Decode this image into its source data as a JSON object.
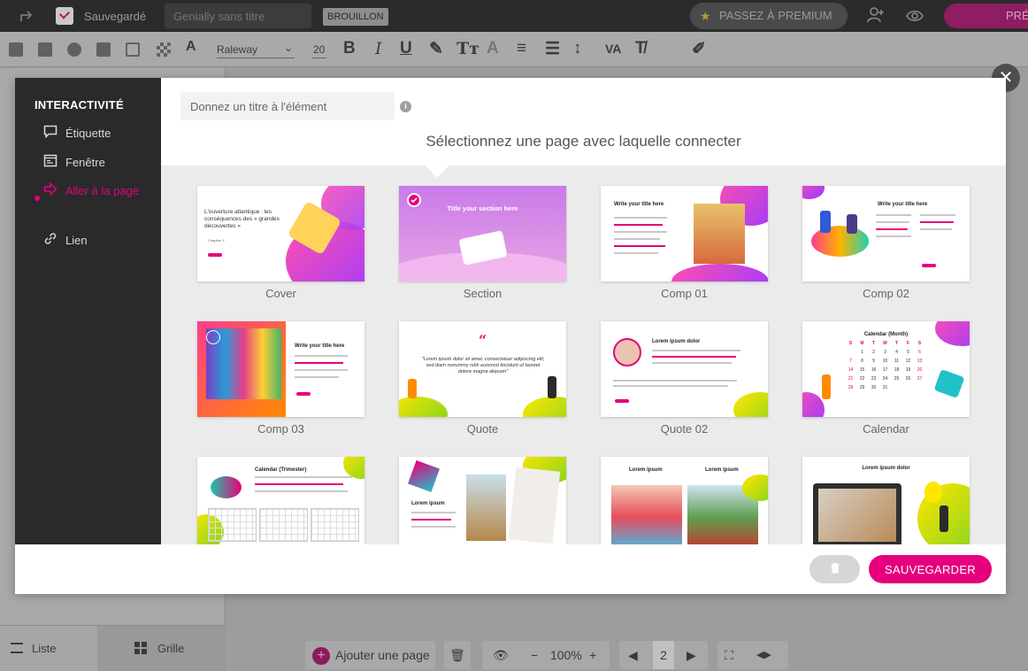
{
  "topbar": {
    "saved_label": "Sauvegardé",
    "title_placeholder": "Genially sans titre",
    "draft_badge": "BROUILLON",
    "premium_label": "PASSEZ À PREMIUM",
    "publish_label": "PRÉ"
  },
  "toolbar": {
    "font_name": "Raleway",
    "font_size": "20"
  },
  "bottom": {
    "list_label": "Liste",
    "grid_label": "Grille",
    "add_page_label": "Ajouter une page",
    "zoom_label": "100%",
    "page_number": "2"
  },
  "modal": {
    "sidebar_title": "INTERACTIVITÉ",
    "sidebar_items": [
      {
        "label": "Étiquette"
      },
      {
        "label": "Fenêtre"
      },
      {
        "label": "Aller à la page"
      },
      {
        "label": "Lien"
      }
    ],
    "name_placeholder": "Donnez un titre à l'élément",
    "select_title": "Sélectionnez une page avec laquelle connecter",
    "save_label": "SAUVEGARDER",
    "pages": [
      {
        "label": "Cover",
        "text": "L'ouverture atlantique : les conséquences des « grandes découvertes »",
        "subtitle": "Chapitre 3"
      },
      {
        "label": "Section",
        "text": "Title your section here",
        "selected": true
      },
      {
        "label": "Comp 01",
        "text": "Write your title here"
      },
      {
        "label": "Comp 02",
        "text": "Write your title here"
      },
      {
        "label": "Comp 03",
        "text": "Write your title here"
      },
      {
        "label": "Quote",
        "text": "\"Lorem ipsum dolor sit amet, consectetuer adipiscing elit, sed diam nonummy nibh euismod tincidunt ut laoreet dolore magna aliquam\""
      },
      {
        "label": "Quote 02",
        "text": "Lorem ipsum dolor"
      },
      {
        "label": "Calendar",
        "text": "Calendar (Month)"
      },
      {
        "label": "",
        "text": "Calendar (Trimester)"
      },
      {
        "label": "",
        "text": "Lorem ipsum"
      },
      {
        "label": "",
        "text": "Lorem ipsum"
      },
      {
        "label": "",
        "text": "Lorem ipsum dolor"
      }
    ],
    "calendar_days": [
      "S",
      "M",
      "T",
      "W",
      "T",
      "F",
      "S"
    ],
    "calendar_numbers": [
      "1",
      "2",
      "3",
      "4",
      "5",
      "6",
      "7",
      "8",
      "9",
      "10",
      "11",
      "12",
      "13",
      "14",
      "15",
      "16",
      "17",
      "18",
      "19",
      "20",
      "21",
      "22",
      "23",
      "24",
      "25",
      "26",
      "27",
      "28",
      "29",
      "30",
      "31"
    ]
  },
  "colors": {
    "accent": "#e6007e",
    "sidebar_bg": "#2a2a2a",
    "grid_bg": "#ebebeb"
  }
}
